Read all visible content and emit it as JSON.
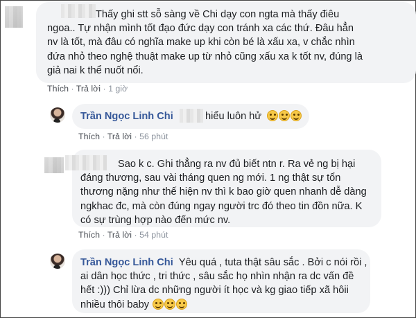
{
  "comments": [
    {
      "lines": [
        "Thấy ghi stt sỗ sàng về Chi dạy con ngta mà thấy điêu",
        "ngoa.. Tự nhận mình tốt đạo đức dạy con tránh xa các thứ. Đâu hẳn",
        "nv là tốt, mà đâu có nghĩa make up khi còn bé là xấu xa, v chắc nhìn",
        "đứa nhỏ theo nghệ thuật make up từ nhỏ cũng xấu xa k tốt nv, đúng là",
        "giả nai k thể nuốt nổi."
      ],
      "actions": {
        "like": "Thích",
        "reply": "Trả lời",
        "time": "1 giờ",
        "sep": "·"
      }
    },
    {
      "author": "Trần Ngọc Linh Chi",
      "text": "hiểu luôn hử",
      "emoji_count": 3,
      "actions": {
        "like": "Thích",
        "reply": "Trả lời",
        "time": "56 phút",
        "sep": "·"
      }
    },
    {
      "lines": [
        "Sao k c. Ghi thẳng ra nv đủ biết ntn r. Ra vẻ ng bị hại",
        "đáng thương, sau vài tháng quen ng mới. 1 ng thật sự tổn",
        "thương nặng như thế hiện nv thì k bao giờ quen nhanh dễ dàng",
        "ngkhac đc, mà còn đúng ngay người trc đó theo tin đồn nữa. K",
        "có sự trùng hợp nào đến mức nv."
      ],
      "actions": {
        "like": "Thích",
        "reply": "Trả lời",
        "time": "54 phút",
        "sep": "·"
      }
    },
    {
      "author": "Trần Ngọc Linh Chi",
      "lines": [
        "Yêu quá , tuta thật sâu sắc . Bởi c nói rồi ,",
        "ai dân học thức , tri thức , sâu sắc họ nhìn nhận ra dc vấn đề",
        "hết :))) Chỉ lừa dc những người ít học và kg giao tiếp xã hôii",
        "nhiều thôi baby"
      ],
      "emoji_count": 3
    }
  ],
  "colors": {
    "author": "#365899",
    "bubble": "#f2f3f5",
    "meta": "#8d949e"
  }
}
